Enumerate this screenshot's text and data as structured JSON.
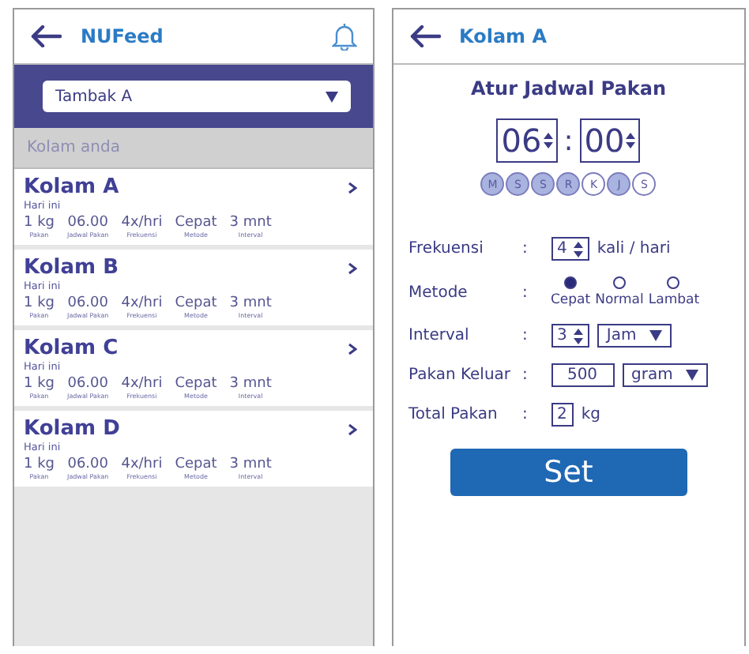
{
  "left": {
    "header": {
      "title": "NUFeed"
    },
    "pond_select": {
      "value": "Tambak A"
    },
    "section_label": "Kolam anda",
    "ponds": [
      {
        "name": "Kolam A",
        "subtitle": "Hari ini",
        "stats": [
          {
            "value": "1 kg",
            "label": "Pakan"
          },
          {
            "value": "06.00",
            "label": "Jadwal Pakan"
          },
          {
            "value": "4x/hri",
            "label": "Frekuensi"
          },
          {
            "value": "Cepat",
            "label": "Metode"
          },
          {
            "value": "3 mnt",
            "label": "Interval"
          }
        ]
      },
      {
        "name": "Kolam B",
        "subtitle": "Hari ini",
        "stats": [
          {
            "value": "1 kg",
            "label": "Pakan"
          },
          {
            "value": "06.00",
            "label": "Jadwal Pakan"
          },
          {
            "value": "4x/hri",
            "label": "Frekuensi"
          },
          {
            "value": "Cepat",
            "label": "Metode"
          },
          {
            "value": "3 mnt",
            "label": "Interval"
          }
        ]
      },
      {
        "name": "Kolam C",
        "subtitle": "Hari ini",
        "stats": [
          {
            "value": "1 kg",
            "label": "Pakan"
          },
          {
            "value": "06.00",
            "label": "Jadwal Pakan"
          },
          {
            "value": "4x/hri",
            "label": "Frekuensi"
          },
          {
            "value": "Cepat",
            "label": "Metode"
          },
          {
            "value": "3 mnt",
            "label": "Interval"
          }
        ]
      },
      {
        "name": "Kolam D",
        "subtitle": "Hari ini",
        "stats": [
          {
            "value": "1 kg",
            "label": "Pakan"
          },
          {
            "value": "06.00",
            "label": "Jadwal Pakan"
          },
          {
            "value": "4x/hri",
            "label": "Frekuensi"
          },
          {
            "value": "Cepat",
            "label": "Metode"
          },
          {
            "value": "3 mnt",
            "label": "Interval"
          }
        ]
      }
    ]
  },
  "right": {
    "header": {
      "title": "Kolam A"
    },
    "title": "Atur Jadwal Pakan",
    "time": {
      "hour": "06",
      "separator": ":",
      "minute": "00"
    },
    "days": [
      {
        "label": "M",
        "selected": true
      },
      {
        "label": "S",
        "selected": true
      },
      {
        "label": "S",
        "selected": true
      },
      {
        "label": "R",
        "selected": true
      },
      {
        "label": "K",
        "selected": false
      },
      {
        "label": "J",
        "selected": true
      },
      {
        "label": "S",
        "selected": false
      }
    ],
    "fields": [
      {
        "kind": "spinner",
        "label": "Frekuensi",
        "separator": ":",
        "value": "4",
        "unit": "kali / hari"
      },
      {
        "kind": "radio",
        "label": "Metode",
        "separator": ":",
        "options": [
          {
            "label": "Cepat",
            "selected": true
          },
          {
            "label": "Normal",
            "selected": false
          },
          {
            "label": "Lambat",
            "selected": false
          }
        ]
      },
      {
        "kind": "spinner-select",
        "label": "Interval",
        "separator": ":",
        "value": "3",
        "select": "Jam"
      },
      {
        "kind": "input-select",
        "label": "Pakan Keluar",
        "separator": ":",
        "value": "500",
        "select": "gram"
      },
      {
        "kind": "input",
        "label": "Total Pakan",
        "separator": ":",
        "value": "2",
        "unit": "kg"
      }
    ],
    "button": "Set"
  }
}
